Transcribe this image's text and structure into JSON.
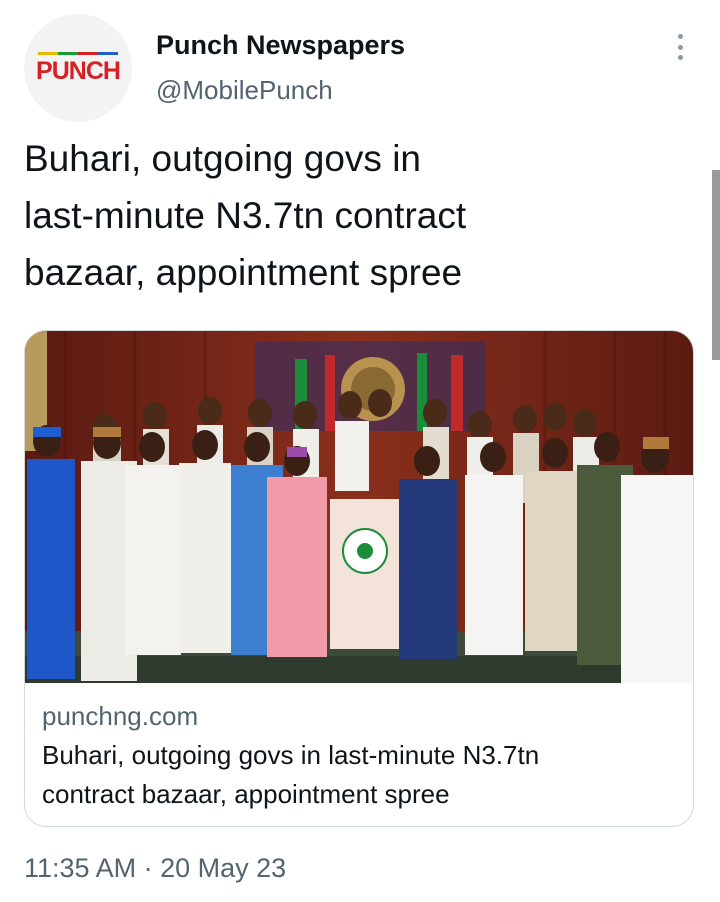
{
  "account": {
    "avatar_text": "PUNCH",
    "display_name": "Punch Newspapers",
    "handle": "@MobilePunch"
  },
  "tweet": {
    "text": "Buhari, outgoing govs in\nlast-minute N3.7tn contract\nbazaar, appointment spree",
    "timestamp": "11:35 AM · 20 May 23"
  },
  "card": {
    "domain": "punchng.com",
    "title": "Buhari, outgoing govs in last-minute N3.7tn\ncontract bazaar, appointment spree"
  },
  "icons": {
    "more": "more-vertical-icon"
  },
  "colors": {
    "text_primary": "#0f1419",
    "text_secondary": "#536471",
    "border": "#cfd9de",
    "brand_red": "#d71f26"
  }
}
